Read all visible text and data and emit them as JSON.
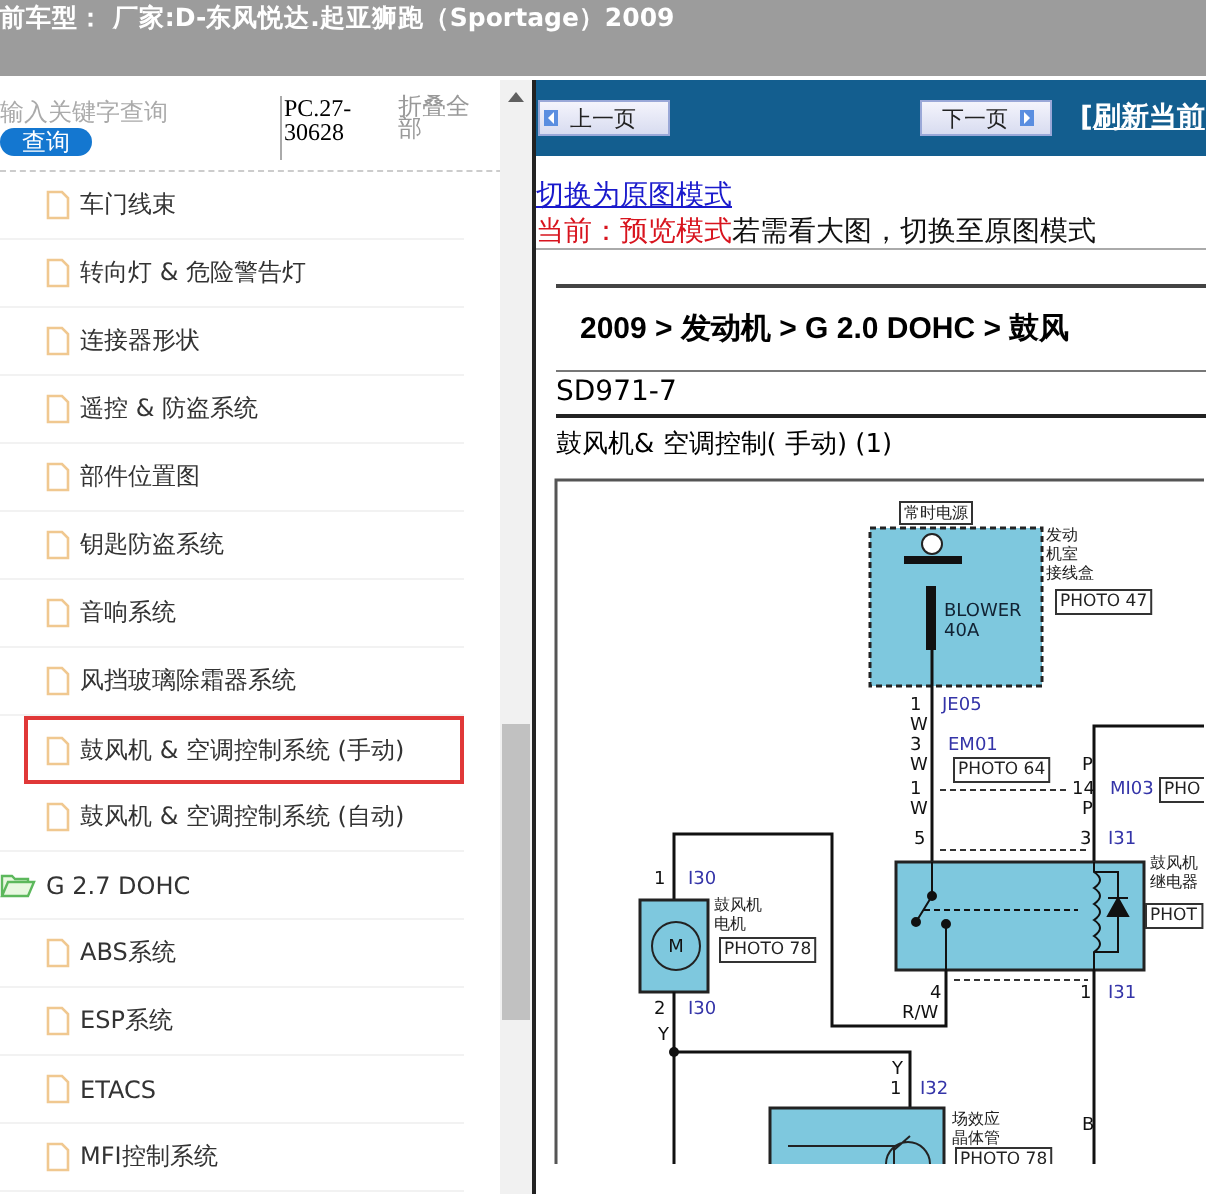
{
  "header": {
    "title": "前车型：  厂家:D-东风悦达.起亚狮跑（Sportage）2009"
  },
  "sidebar": {
    "search": {
      "placeholder": "输入关键字查询"
    },
    "search_button": "查询",
    "code": "PC.27-30628",
    "collapse_all": "折叠全部",
    "tree": [
      {
        "children": [
          {
            "label": "车门线束",
            "kind": "file",
            "selected": false
          },
          {
            "label": "转向灯 & 危险警告灯",
            "kind": "file",
            "selected": false
          },
          {
            "label": "连接器形状",
            "kind": "file",
            "selected": false
          },
          {
            "label": "遥控 & 防盗系统",
            "kind": "file",
            "selected": false
          },
          {
            "label": "部件位置图",
            "kind": "file",
            "selected": false
          },
          {
            "label": "钥匙防盗系统",
            "kind": "file",
            "selected": false
          },
          {
            "label": "音响系统",
            "kind": "file",
            "selected": false
          },
          {
            "label": "风挡玻璃除霜器系统",
            "kind": "file",
            "selected": false
          },
          {
            "label": "鼓风机 & 空调控制系统 (手动)",
            "kind": "file",
            "selected": true
          },
          {
            "label": "鼓风机 & 空调控制系统 (自动)",
            "kind": "file",
            "selected": false
          }
        ]
      },
      {
        "label": "G 2.7 DOHC",
        "kind": "folder",
        "selected": false,
        "expanded": true,
        "children": [
          {
            "label": "ABS系统",
            "kind": "file",
            "selected": false
          },
          {
            "label": "ESP系统",
            "kind": "file",
            "selected": false
          },
          {
            "label": "ETACS",
            "kind": "file",
            "selected": false
          },
          {
            "label": "MFI控制系统",
            "kind": "file",
            "selected": false
          }
        ]
      }
    ]
  },
  "toolbar": {
    "prev_button": "上一页",
    "next_button": "下一页",
    "refresh_link": "[刷新当前"
  },
  "mode": {
    "switch_link": "切换为原图模式",
    "current_label": "当前：预览模式",
    "hint": "若需看大图，切换至原图模式"
  },
  "document": {
    "breadcrumb": "2009 > 发动机 > G 2.0 DOHC > 鼓风",
    "code": "SD971-7",
    "subtitle": "鼓风机& 空调控制( 手动) (1)",
    "diagram": {
      "labels": [
        {
          "kind": "box",
          "lines": [
            "常时电源"
          ]
        },
        {
          "kind": "plain",
          "lines": [
            "BLOWER"
          ]
        },
        {
          "kind": "plain",
          "lines": [
            "40A"
          ]
        },
        {
          "kind": "note",
          "lines": [
            "发动",
            "机室",
            "接线盒"
          ]
        },
        {
          "kind": "photo",
          "lines": [
            "PHOTO 47"
          ]
        },
        {
          "kind": "pin",
          "lines": [
            "1"
          ]
        },
        {
          "kind": "connector",
          "lines": [
            "JE05"
          ]
        },
        {
          "kind": "pin",
          "lines": [
            "W"
          ]
        },
        {
          "kind": "pin",
          "lines": [
            "3"
          ]
        },
        {
          "kind": "connector",
          "lines": [
            "EM01"
          ]
        },
        {
          "kind": "pin",
          "lines": [
            "W"
          ]
        },
        {
          "kind": "photo",
          "lines": [
            "PHOTO 64"
          ]
        },
        {
          "kind": "pin",
          "lines": [
            "1"
          ]
        },
        {
          "kind": "pin",
          "lines": [
            "W"
          ]
        },
        {
          "kind": "pin",
          "lines": [
            "P"
          ]
        },
        {
          "kind": "pin",
          "lines": [
            "14"
          ]
        },
        {
          "kind": "connector",
          "lines": [
            "MI03"
          ]
        },
        {
          "kind": "photo",
          "lines": [
            "PHO"
          ]
        },
        {
          "kind": "pin",
          "lines": [
            "P"
          ]
        },
        {
          "kind": "pin",
          "lines": [
            "5"
          ]
        },
        {
          "kind": "pin",
          "lines": [
            "3"
          ]
        },
        {
          "kind": "connector",
          "lines": [
            "I31"
          ]
        },
        {
          "kind": "note",
          "lines": [
            "鼓风机",
            "继电器"
          ]
        },
        {
          "kind": "photo",
          "lines": [
            "PHOT"
          ]
        },
        {
          "kind": "pin",
          "lines": [
            "4"
          ]
        },
        {
          "kind": "pin",
          "lines": [
            "R/W"
          ]
        },
        {
          "kind": "pin",
          "lines": [
            "1"
          ]
        },
        {
          "kind": "connector",
          "lines": [
            "I31"
          ]
        },
        {
          "kind": "pin",
          "lines": [
            "1"
          ]
        },
        {
          "kind": "connector",
          "lines": [
            "I30"
          ]
        },
        {
          "kind": "note",
          "lines": [
            "鼓风机",
            "电机"
          ]
        },
        {
          "kind": "photo",
          "lines": [
            "PHOTO 78"
          ]
        },
        {
          "kind": "pin",
          "lines": [
            "M"
          ]
        },
        {
          "kind": "pin",
          "lines": [
            "2"
          ]
        },
        {
          "kind": "connector",
          "lines": [
            "I30"
          ]
        },
        {
          "kind": "pin",
          "lines": [
            "Y"
          ]
        },
        {
          "kind": "pin",
          "lines": [
            "Y"
          ]
        },
        {
          "kind": "pin",
          "lines": [
            "1"
          ]
        },
        {
          "kind": "connector",
          "lines": [
            "I32"
          ]
        },
        {
          "kind": "note",
          "lines": [
            "场效应",
            "晶体管"
          ]
        },
        {
          "kind": "photo",
          "lines": [
            "PHOTO 78"
          ]
        },
        {
          "kind": "pin",
          "lines": [
            "B"
          ]
        }
      ]
    }
  }
}
